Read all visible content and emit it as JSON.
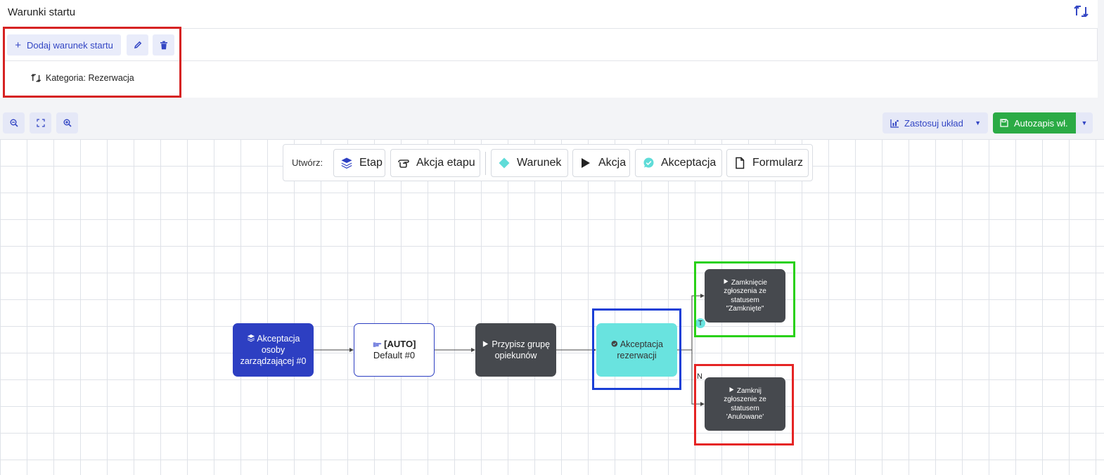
{
  "header": {
    "title": "Warunki startu"
  },
  "conditions": {
    "add_label": "Dodaj warunek startu",
    "items": [
      {
        "label": "Kategoria: Rezerwacja"
      }
    ]
  },
  "toolbar": {
    "layout_label": "Zastosuj układ",
    "autosave_label": "Autozapis wł."
  },
  "palette": {
    "create_label": "Utwórz:",
    "buttons": [
      {
        "label": "Etap",
        "icon": "layers-icon"
      },
      {
        "label": "Akcja etapu",
        "icon": "hand-pointer-icon"
      },
      {
        "label": "Warunek",
        "icon": "diamond-icon"
      },
      {
        "label": "Akcja",
        "icon": "play-icon"
      },
      {
        "label": "Akceptacja",
        "icon": "approval-chat-icon"
      },
      {
        "label": "Formularz",
        "icon": "file-icon"
      }
    ]
  },
  "workflow": {
    "stage": {
      "label": "Akceptacja osoby zarządzającej #0"
    },
    "stage_action": {
      "tag": "[AUTO]",
      "label": "Default #0"
    },
    "assign": {
      "label": "Przypisz grupę opiekunów"
    },
    "accept": {
      "label": "Akceptacja rezerwacji"
    },
    "close_yes": {
      "label": "Zamknięcie zgłoszenia ze statusem \"Zamknięte\""
    },
    "close_no": {
      "label": "Zamknij zgłoszenie ze statusem 'Anulowane'"
    },
    "branch_true": "T",
    "branch_false": "N"
  },
  "colors": {
    "stage": "#2d3fc2",
    "action": "#46494e",
    "acceptance": "#69e3df",
    "autosave": "#2bab45",
    "highlight_red": "#d62323",
    "highlight_green": "#29d117",
    "highlight_blue": "#1a3fd6"
  }
}
